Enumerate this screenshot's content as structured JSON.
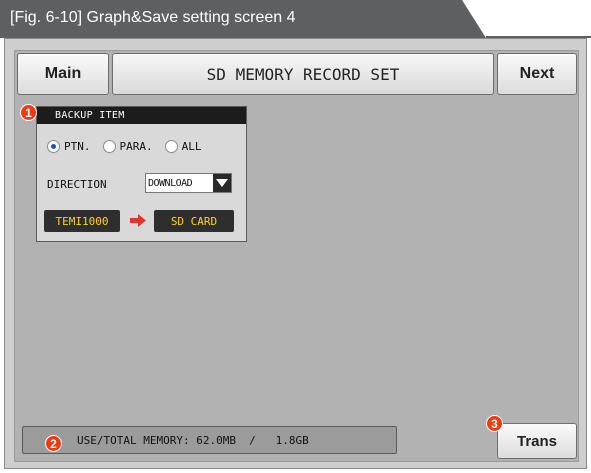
{
  "figure": {
    "caption": "[Fig. 6-10] Graph&Save setting screen 4"
  },
  "header": {
    "main_label": "Main",
    "title": "SD MEMORY RECORD SET",
    "next_label": "Next"
  },
  "backup": {
    "badge": "1",
    "title": "BACKUP ITEM",
    "options": [
      "PTN.",
      "PARA.",
      "ALL"
    ],
    "selected": "PTN.",
    "direction_label": "DIRECTION",
    "direction_value": "DOWNLOAD",
    "source": "TEMI1000",
    "destination": "SD CARD"
  },
  "memory": {
    "badge": "2",
    "label": "USE/TOTAL MEMORY: 62.0MB  /   1.8GB"
  },
  "trans": {
    "badge": "3",
    "label": "Trans"
  },
  "colors": {
    "badge": "#f03b12",
    "chip_text": "#ffd31a",
    "radio_selected": "#1a52c9",
    "screen_bg": "#b2b2b2"
  }
}
